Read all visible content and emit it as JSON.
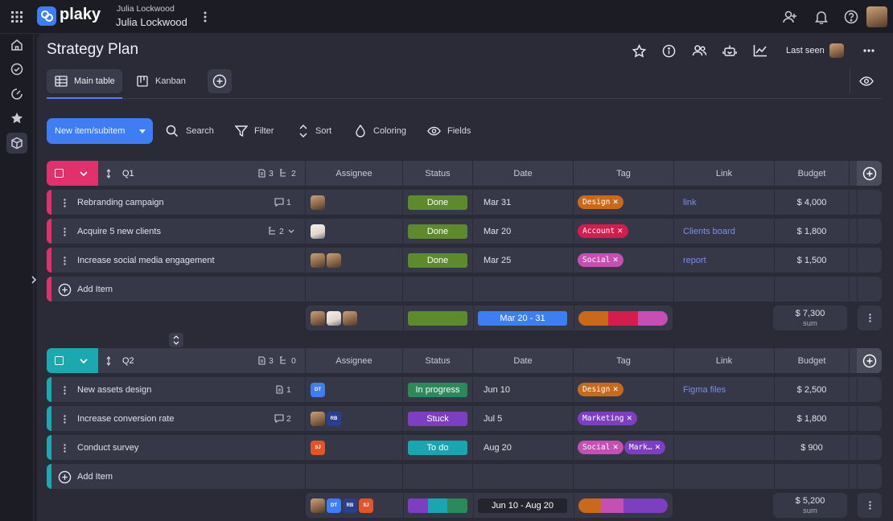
{
  "app": {
    "name": "plaky",
    "workspace_top": "Julia Lockwood",
    "workspace_name": "Julia Lockwood"
  },
  "board": {
    "title": "Strategy Plan",
    "last_seen_label": "Last seen"
  },
  "views": {
    "tabs": [
      {
        "label": "Main table"
      },
      {
        "label": "Kanban"
      }
    ]
  },
  "toolbar": {
    "new_item": "New item/subitem",
    "search": "Search",
    "filter": "Filter",
    "sort": "Sort",
    "coloring": "Coloring",
    "fields": "Fields"
  },
  "columns": [
    "Assignee",
    "Status",
    "Date",
    "Tag",
    "Link",
    "Budget"
  ],
  "groups": [
    {
      "name": "Q1",
      "files_count": "3",
      "subitems_count": "2",
      "color": "#e2306c",
      "items": [
        {
          "name": "Rebranding campaign",
          "meta": "1",
          "status": "Done",
          "status_color": "#5c8a2c",
          "date": "Mar 31",
          "tags": [
            {
              "label": "Design",
              "color": "#c96a1b"
            }
          ],
          "link": "link",
          "budget": "$ 4,000"
        },
        {
          "name": "Acquire 5 new clients",
          "meta": "2",
          "status": "Done",
          "status_color": "#5c8a2c",
          "date": "Mar 20",
          "tags": [
            {
              "label": "Account",
              "color": "#d81b4d"
            }
          ],
          "link": "Clients board",
          "budget": "$ 1,800"
        },
        {
          "name": "Increase social media engagement",
          "meta": "",
          "status": "Done",
          "status_color": "#5c8a2c",
          "date": "Mar 25",
          "tags": [
            {
              "label": "Social",
              "color": "#c64fb4"
            }
          ],
          "link": "report",
          "budget": "$ 1,500"
        }
      ],
      "add_item": "Add Item",
      "summary": {
        "date_range": "Mar 20 - 31",
        "budget": "$ 7,300",
        "budget_label": "sum"
      }
    },
    {
      "name": "Q2",
      "files_count": "3",
      "subitems_count": "0",
      "color": "#1ba9b0",
      "items": [
        {
          "name": "New assets design",
          "meta": "1",
          "status": "In progress",
          "status_color": "#2b8a5a",
          "date": "Jun 10",
          "tags": [
            {
              "label": "Design",
              "color": "#c96a1b"
            }
          ],
          "link": "Figma files",
          "budget": "$ 2,500"
        },
        {
          "name": "Increase conversion rate",
          "meta": "2",
          "status": "Stuck",
          "status_color": "#7d3fc2",
          "date": "Jul 5",
          "tags": [
            {
              "label": "Marketing",
              "color": "#7d3fc2"
            }
          ],
          "link": "",
          "budget": "$ 1,800"
        },
        {
          "name": "Conduct survey",
          "meta": "",
          "status": "To do",
          "status_color": "#1aa6b0",
          "date": "Aug 20",
          "tags": [
            {
              "label": "Social",
              "color": "#c64fb4"
            },
            {
              "label": "Mark…",
              "color": "#7d3fc2"
            }
          ],
          "link": "",
          "budget": "$ 900"
        }
      ],
      "add_item": "Add Item",
      "summary": {
        "date_range": "Jun 10 - Aug 20",
        "budget": "$ 5,200",
        "budget_label": "sum"
      }
    }
  ],
  "avatars": {
    "dt": "DT",
    "rb": "RB",
    "sj": "SJ"
  },
  "icons": [
    "apps-grid-icon",
    "home-icon",
    "check-circle-icon",
    "gauge-icon",
    "star-icon",
    "box-icon",
    "add-user-icon",
    "bell-icon",
    "help-icon",
    "star-outline-icon",
    "info-icon",
    "people-icon",
    "robot-icon",
    "chart-icon",
    "more-icon",
    "eye-icon",
    "plus-circle-icon",
    "search-icon",
    "filter-icon",
    "sort-icon",
    "drop-icon",
    "eye-fields-icon",
    "chevron-right-icon",
    "comment-icon",
    "subitems-icon",
    "file-icon"
  ],
  "colors": {
    "accent": "#3e7ef5",
    "q1": "#e2306c",
    "q2": "#1ba9b0",
    "done": "#5c8a2c",
    "date_bar": "#3e7ef5"
  }
}
